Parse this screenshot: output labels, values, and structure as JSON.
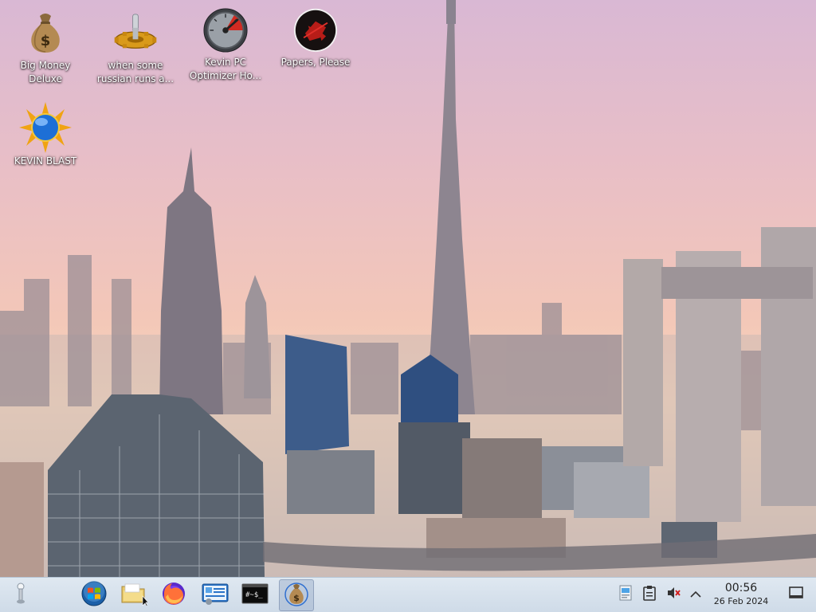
{
  "desktop": {
    "icons": [
      {
        "label": "Big Money Deluxe",
        "icon": "money-bag-icon"
      },
      {
        "label": "when some russian runs a...",
        "icon": "gear-icon"
      },
      {
        "label": "Kevin PC Optimizer Ho...",
        "icon": "gauge-icon"
      },
      {
        "label": "Papers, Please",
        "icon": "papers-please-icon"
      },
      {
        "label": "KEVIN BLAST",
        "icon": "sun-globe-icon"
      }
    ]
  },
  "taskbar": {
    "apps": [
      {
        "icon": "application-launcher-icon"
      },
      {
        "icon": "windows-start-icon"
      },
      {
        "icon": "file-manager-icon"
      },
      {
        "icon": "firefox-icon"
      },
      {
        "icon": "system-settings-icon"
      },
      {
        "icon": "terminal-icon"
      },
      {
        "icon": "money-bag-icon",
        "active": true
      }
    ],
    "tray": [
      {
        "icon": "updates-icon"
      },
      {
        "icon": "clipboard-icon"
      },
      {
        "icon": "volume-muted-icon"
      },
      {
        "icon": "chevron-up-icon"
      }
    ],
    "clock": {
      "time": "00:56",
      "date": "26 Feb 2024"
    },
    "show_desktop": {
      "icon": "show-desktop-icon"
    }
  },
  "colors": {
    "taskbar_bg": "#d6e1ec",
    "label_text": "#ffffff",
    "sky_top": "#d9b8d4",
    "sky_horizon": "#f6d7bc"
  }
}
